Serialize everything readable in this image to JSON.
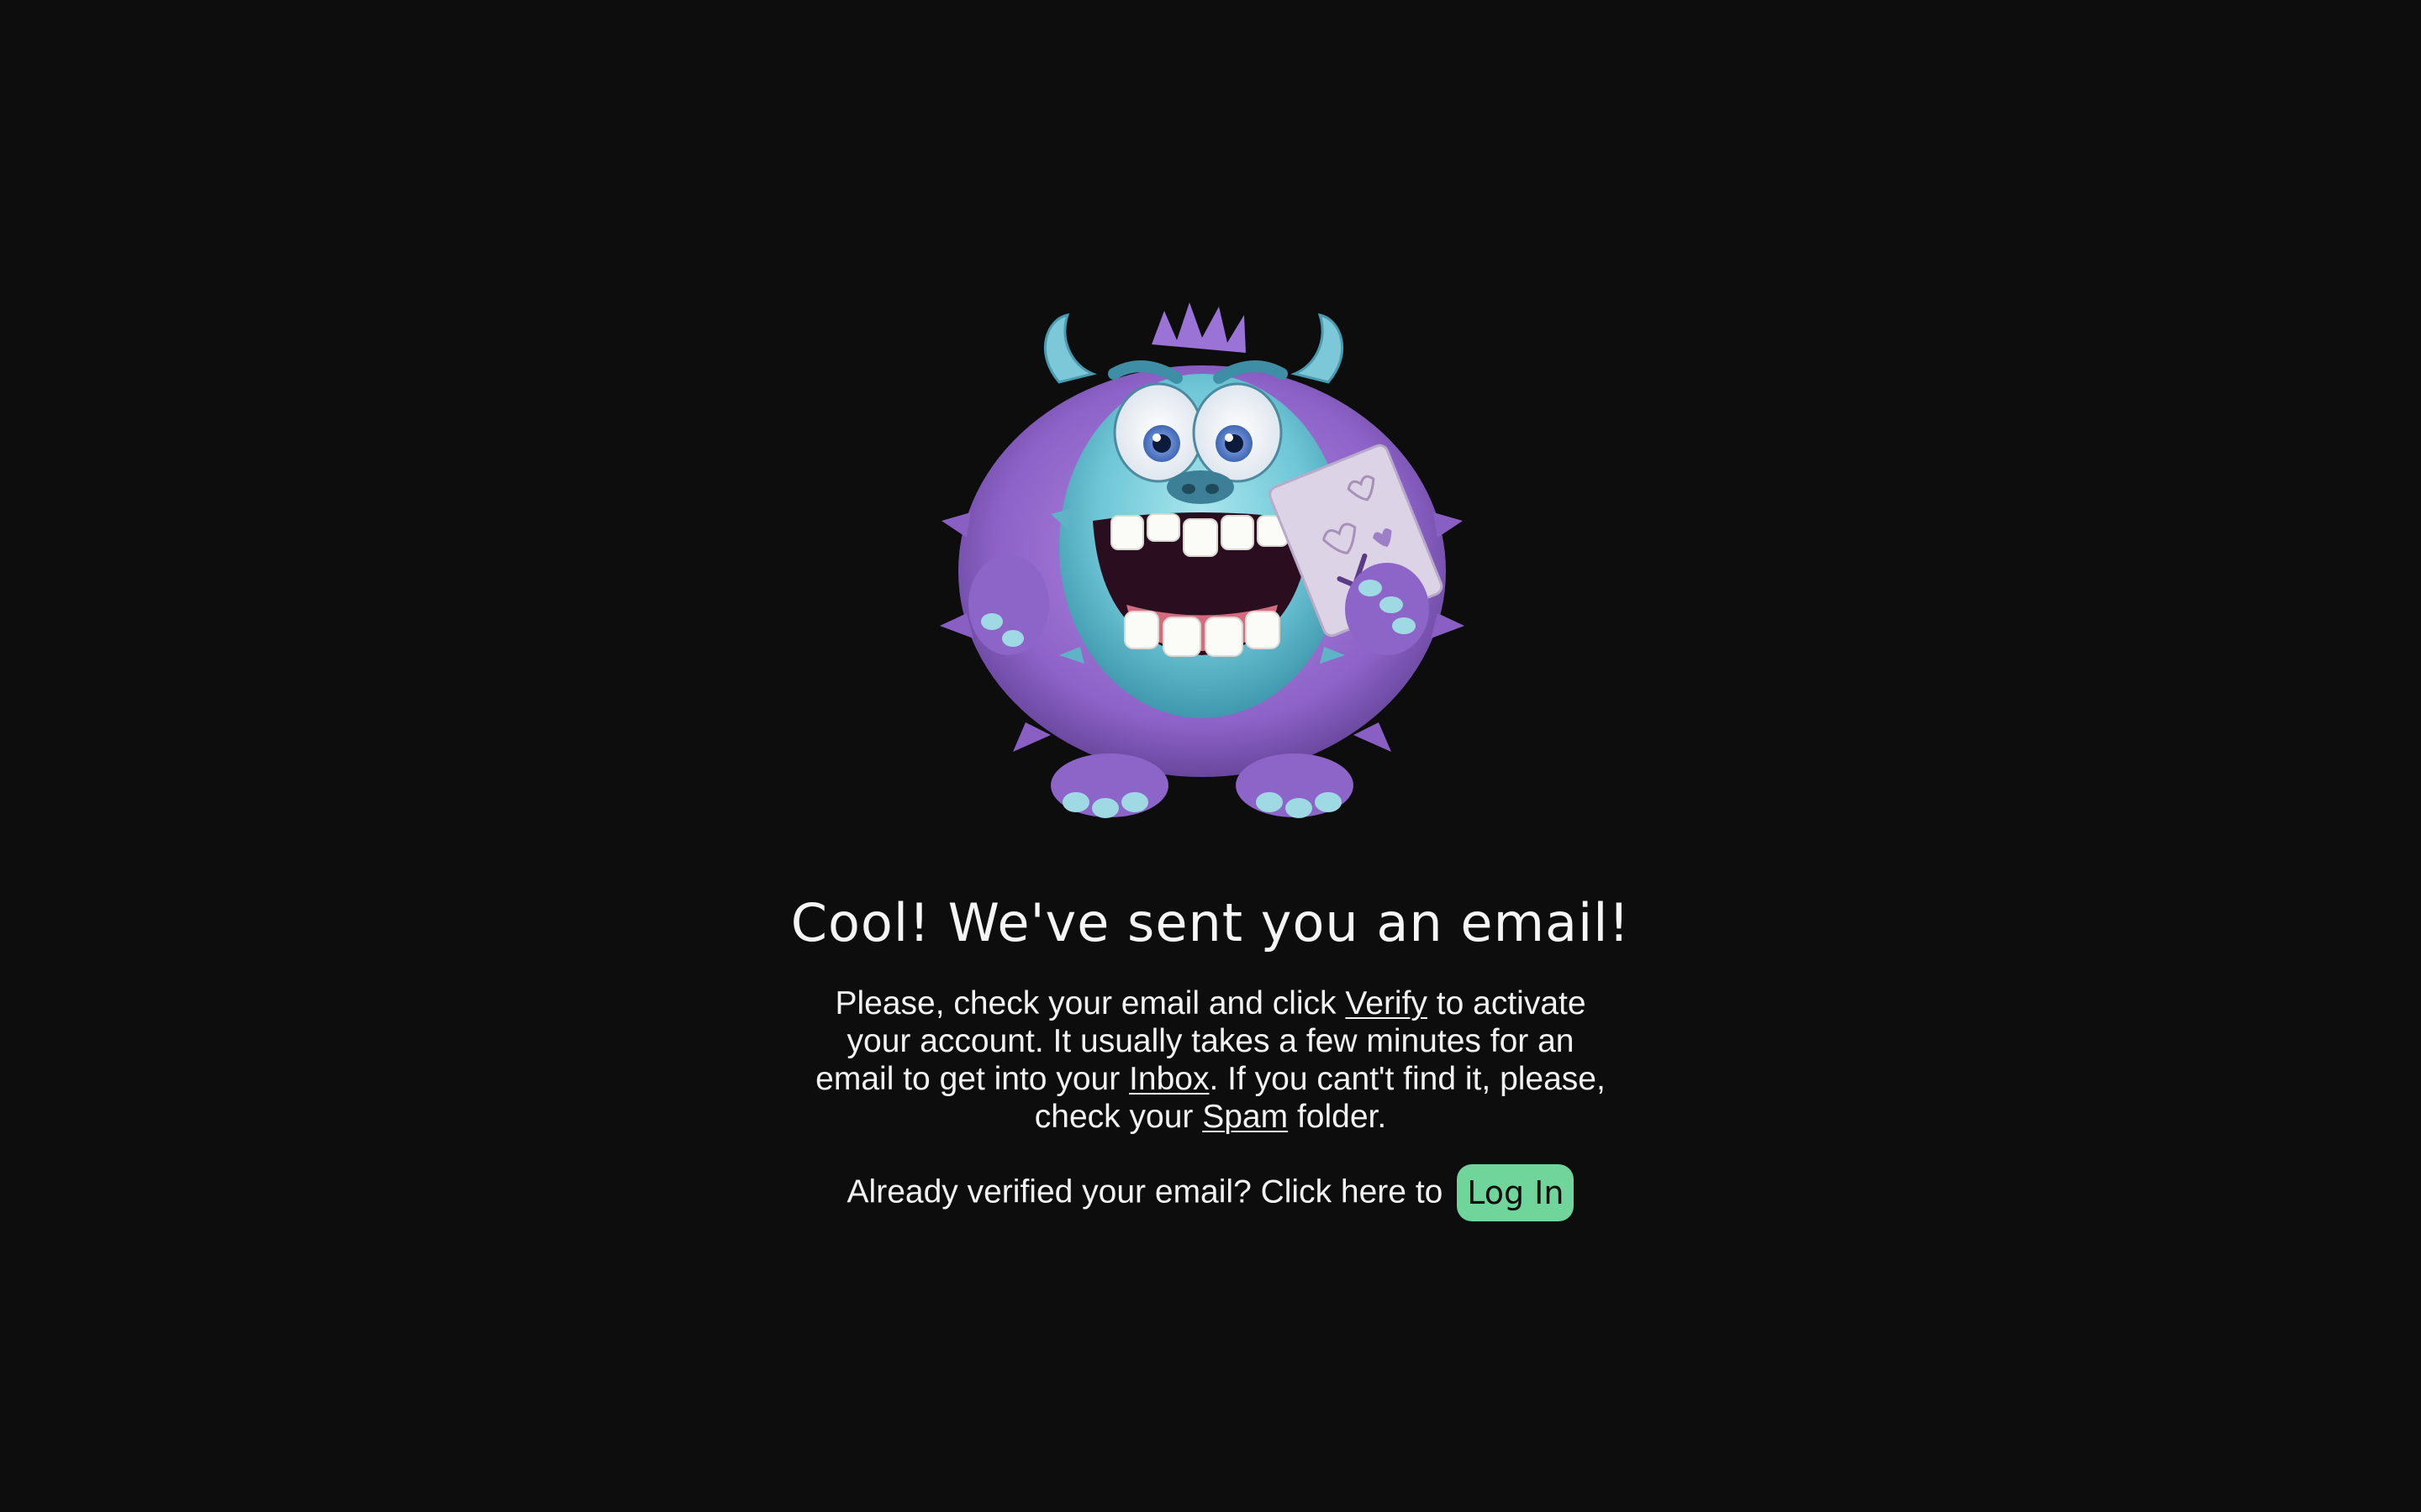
{
  "confirmation": {
    "heading": "Cool! We've sent you an email!",
    "body_part1": "Please, check your email and click ",
    "verify_link": "Verify",
    "body_part2": " to activate your account. It usually takes a few minutes for an email to get into your ",
    "inbox_link": "Inbox",
    "body_part3": ". If you cant't find it, please, check your ",
    "spam_link": "Spam",
    "body_part4": " folder.",
    "login_prompt": "Already verified your email? Click here to",
    "login_button": "Log In"
  },
  "mascot": {
    "icon": "monster-holding-letter-illustration"
  },
  "colors": {
    "background": "#0d0d0d",
    "text": "#ffffff",
    "login_button_bg": "#6fd59a",
    "login_button_text": "#0d0d0d"
  }
}
